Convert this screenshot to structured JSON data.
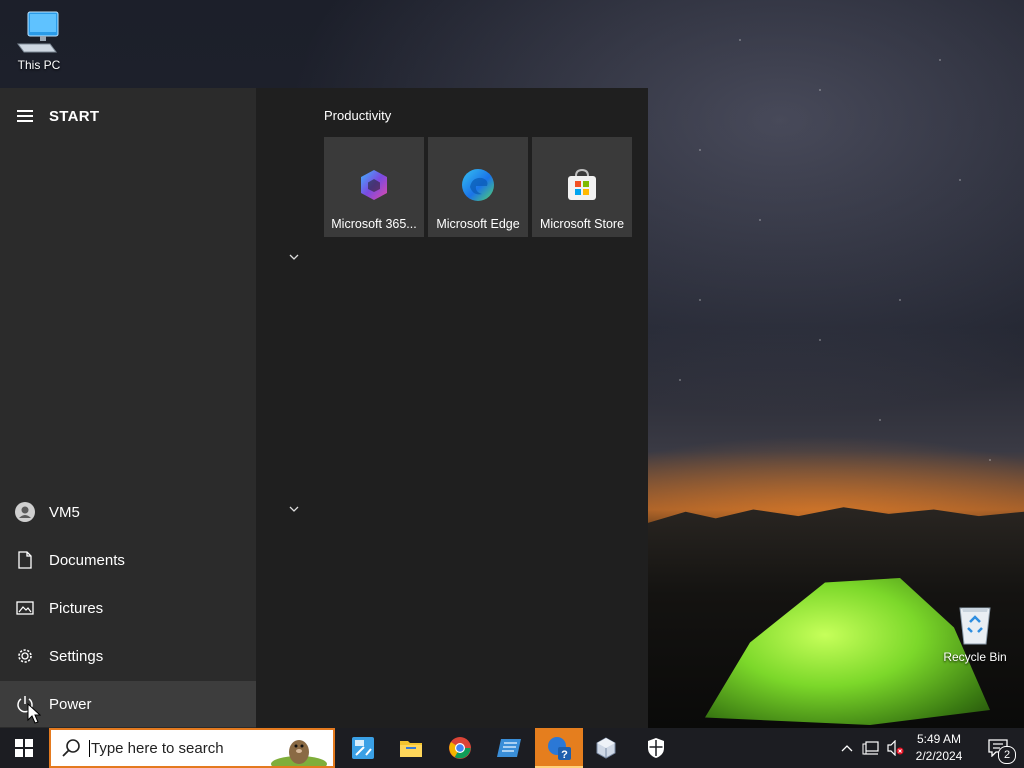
{
  "desktop": {
    "icons": [
      {
        "label": "This PC",
        "icon": "computer-icon"
      },
      {
        "label": "Recycle Bin",
        "icon": "recycle-bin-icon"
      }
    ]
  },
  "start_menu": {
    "title": "START",
    "rail": {
      "user": "VM5",
      "documents": "Documents",
      "pictures": "Pictures",
      "settings": "Settings",
      "power": "Power"
    },
    "groups": [
      {
        "title": "Productivity",
        "tiles": [
          {
            "label": "Microsoft 365...",
            "icon": "microsoft-365-icon"
          },
          {
            "label": "Microsoft Edge",
            "icon": "edge-icon"
          },
          {
            "label": "Microsoft Store",
            "icon": "store-icon"
          }
        ]
      }
    ]
  },
  "taskbar": {
    "search_placeholder": "Type here to search",
    "apps": [
      {
        "name": "calculator-app",
        "icon": "calculator-icon"
      },
      {
        "name": "file-explorer",
        "icon": "folder-icon"
      },
      {
        "name": "chrome",
        "icon": "chrome-icon"
      },
      {
        "name": "app-blue",
        "icon": "app-icon"
      },
      {
        "name": "help-app",
        "icon": "help-icon",
        "running": true
      },
      {
        "name": "virtualbox",
        "icon": "cube-icon"
      },
      {
        "name": "security",
        "icon": "shield-icon"
      }
    ],
    "clock": {
      "time": "5:49 AM",
      "date": "2/2/2024"
    },
    "notification_count": "2"
  },
  "colors": {
    "accent": "#e57e1e",
    "taskbar_bg": "#1c1d22",
    "start_bg": "#1f1f1f",
    "rail_bg": "#2b2b2b",
    "tile_bg": "#3a3a3a"
  }
}
